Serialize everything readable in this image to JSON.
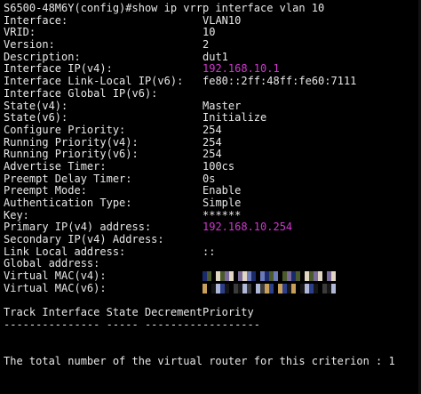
{
  "prompt": "S6500-48M6Y(config)#show ip vrrp interface vlan 10",
  "rows": [
    {
      "key": "Interface:",
      "value": "VLAN10"
    },
    {
      "key": "VRID:",
      "value": "10"
    },
    {
      "key": "Version:",
      "value": "2"
    },
    {
      "key": "Description:",
      "value": "dut1"
    },
    {
      "key": "Interface IP(v4):",
      "value": "192.168.10.1"
    },
    {
      "key": "Interface Link-Local IP(v6):",
      "value": "fe80::2ff:48ff:fe60:7111"
    },
    {
      "key": "Interface Global IP(v6):",
      "value": ""
    },
    {
      "key": "State(v4):",
      "value": "Master"
    },
    {
      "key": "State(v6):",
      "value": "Initialize"
    },
    {
      "key": "Configure Priority:",
      "value": "254"
    },
    {
      "key": "Running Priority(v4):",
      "value": "254"
    },
    {
      "key": "Running Priority(v6):",
      "value": "254"
    },
    {
      "key": "Advertise Timer:",
      "value": "100cs"
    },
    {
      "key": "Preempt Delay Timer:",
      "value": "0s"
    },
    {
      "key": "Preempt Mode:",
      "value": "Enable"
    },
    {
      "key": "Authentication Type:",
      "value": "Simple"
    },
    {
      "key": "Key:",
      "value": "******"
    },
    {
      "key": "Primary IP(v4) address:",
      "value": "192.168.10.254"
    },
    {
      "key": "Secondary IP(v4) Address:",
      "value": ""
    },
    {
      "key": "Link Local address:",
      "value": "::"
    },
    {
      "key": "Global address:",
      "value": ""
    },
    {
      "key": "Virtual MAC(v4):",
      "value": ""
    },
    {
      "key": "Virtual MAC(v6):",
      "value": ""
    }
  ],
  "track_header": "Track Interface State DecrementPriority",
  "track_separator": "--------------- ----- ------------------",
  "total_line": "The total number of the virtual router for this criterion : 1",
  "colors": {
    "background": "#000000",
    "text": "#e8e8e8",
    "highlight": "#d236d2"
  }
}
